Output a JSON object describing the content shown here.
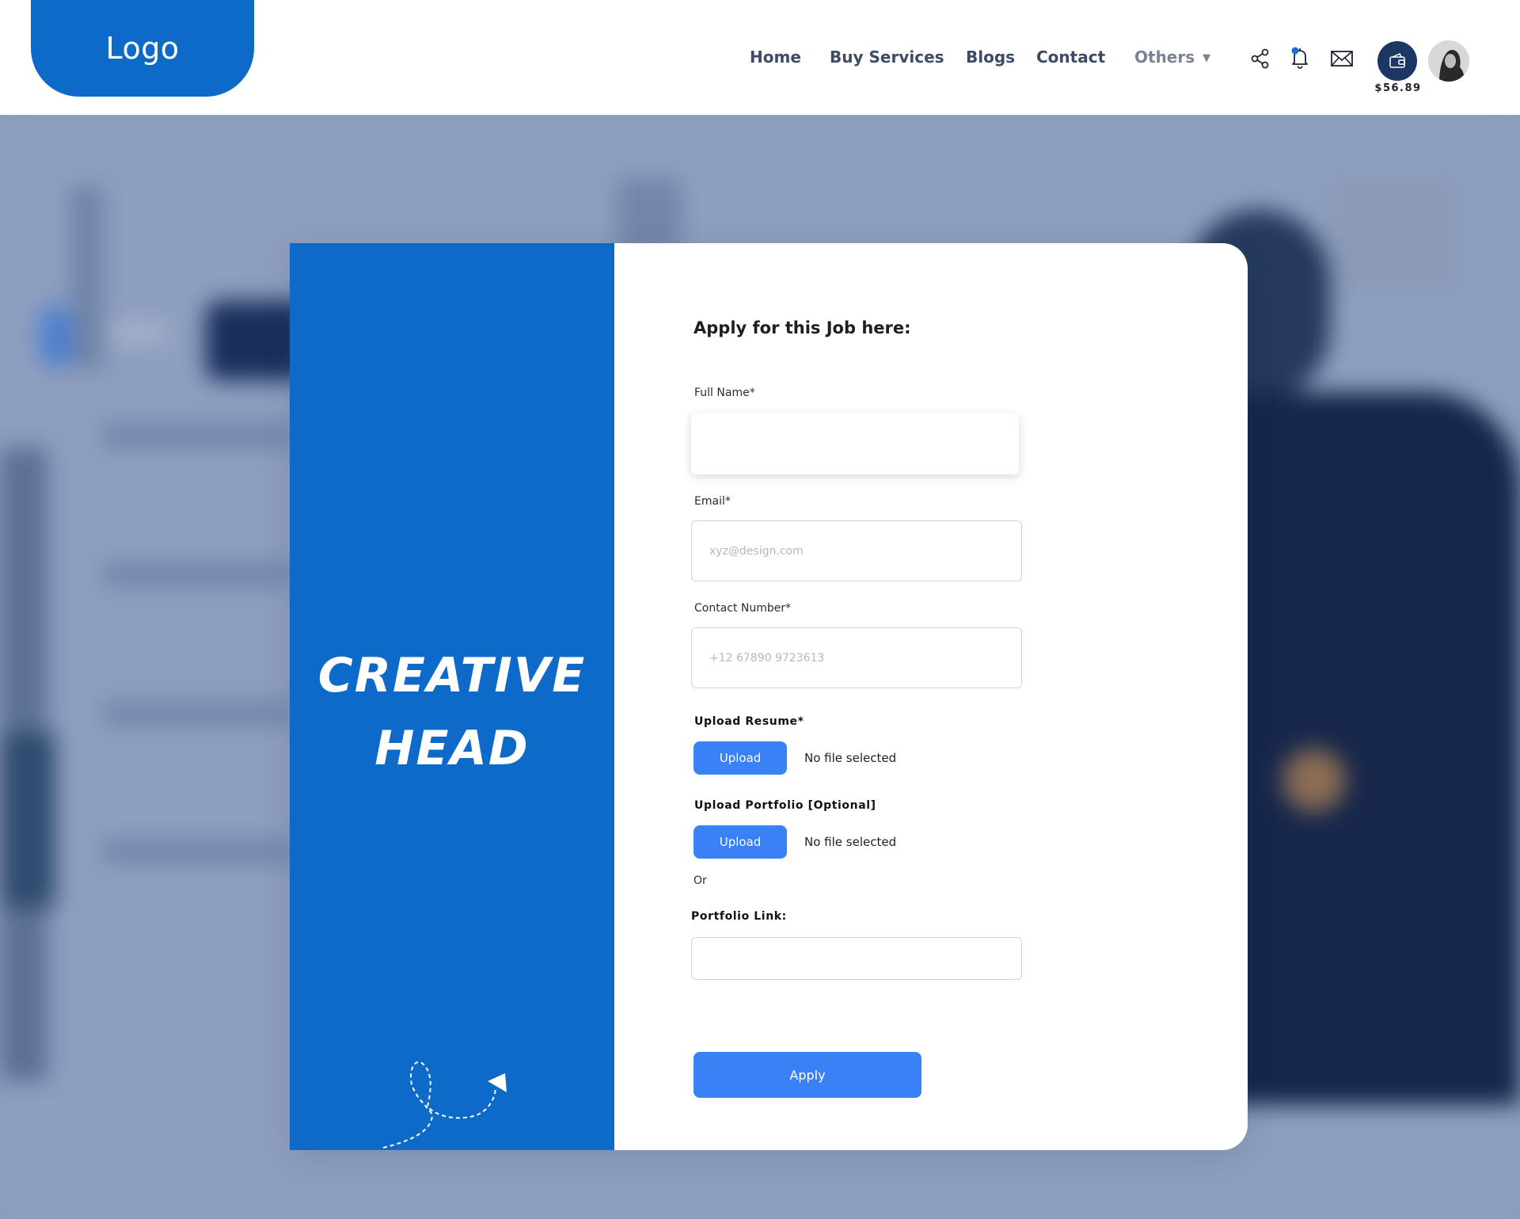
{
  "header": {
    "logo_text": "Logo",
    "nav": [
      {
        "label": "Home"
      },
      {
        "label": "Buy Services"
      },
      {
        "label": "Blogs"
      },
      {
        "label": "Contact"
      },
      {
        "label": "Others"
      }
    ],
    "icons": [
      "share-icon",
      "bell-icon",
      "mail-icon"
    ],
    "wallet_amount": "$56.89"
  },
  "side_panel": {
    "title_line1": "CREATIVE",
    "title_line2": "HEAD"
  },
  "form": {
    "heading": "Apply for this Job here:",
    "full_name": {
      "label": "Full Name*",
      "value": "",
      "placeholder": ""
    },
    "email": {
      "label": "Email*",
      "value": "",
      "placeholder": "xyz@design.com"
    },
    "contact": {
      "label": "Contact Number*",
      "value": "",
      "placeholder": "+12 67890 9723613"
    },
    "resume": {
      "label": "Upload Resume*",
      "button": "Upload",
      "status": "No file selected"
    },
    "portfolio": {
      "label": "Upload Portfolio [Optional]",
      "button": "Upload",
      "status": "No file selected"
    },
    "or_text": "Or",
    "portfolio_link": {
      "label": "Portfolio Link:",
      "value": "",
      "placeholder": ""
    },
    "submit": "Apply"
  },
  "colors": {
    "primary_blue": "#0d6ac8",
    "button_blue": "#3a81f6",
    "wallet_navy": "#1c3763",
    "backdrop": "#8c9dbd"
  }
}
